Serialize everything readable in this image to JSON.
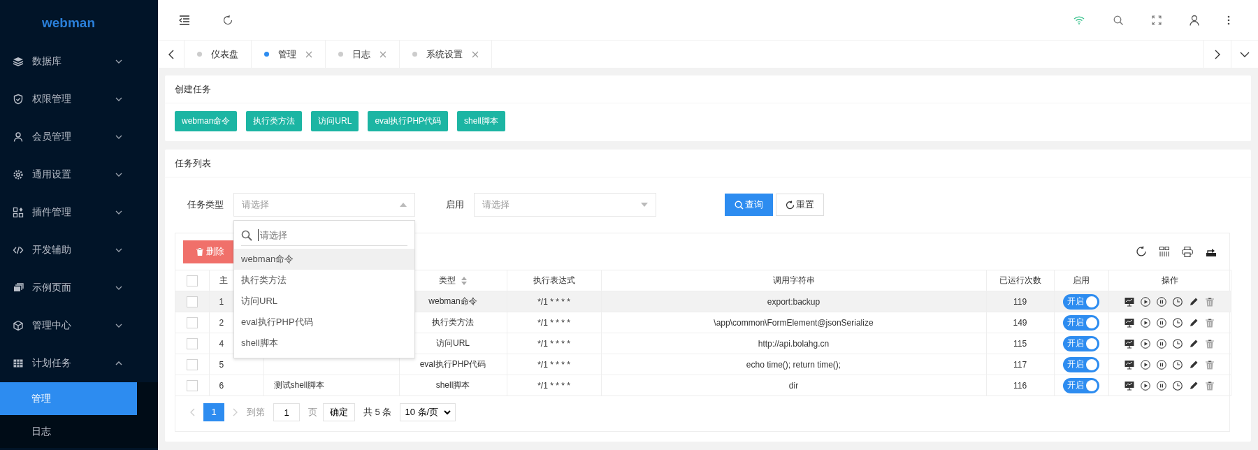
{
  "sidebar": {
    "logo": "webman",
    "items": [
      {
        "label": "数据库",
        "expanded": false
      },
      {
        "label": "权限管理",
        "expanded": false
      },
      {
        "label": "会员管理",
        "expanded": false
      },
      {
        "label": "通用设置",
        "expanded": false
      },
      {
        "label": "插件管理",
        "expanded": false
      },
      {
        "label": "开发辅助",
        "expanded": false
      },
      {
        "label": "示例页面",
        "expanded": false
      },
      {
        "label": "管理中心",
        "expanded": false
      },
      {
        "label": "计划任务",
        "expanded": true,
        "children": [
          {
            "label": "管理",
            "selected": true
          },
          {
            "label": "日志",
            "selected": false
          }
        ]
      }
    ]
  },
  "tabs": [
    {
      "label": "仪表盘",
      "selected": false,
      "closable": false
    },
    {
      "label": "管理",
      "selected": true,
      "closable": true
    },
    {
      "label": "日志",
      "selected": false,
      "closable": true
    },
    {
      "label": "系统设置",
      "selected": false,
      "closable": true
    }
  ],
  "create_card": {
    "title": "创建任务",
    "buttons": [
      "webman命令",
      "执行类方法",
      "访问URL",
      "eval执行PHP代码",
      "shell脚本"
    ]
  },
  "list_card": {
    "title": "任务列表",
    "filters": [
      {
        "label": "任务类型",
        "placeholder": "请选择",
        "expanded": true
      },
      {
        "label": "启用",
        "placeholder": "请选择",
        "expanded": false
      }
    ],
    "buttons": [
      {
        "label": "查询",
        "kind": "primary"
      },
      {
        "label": "重置",
        "kind": "default"
      }
    ],
    "dropdown": {
      "search_placeholder": "请选择",
      "options": [
        {
          "label": "webman命令",
          "highlighted": true
        },
        {
          "label": "执行类方法",
          "highlighted": false
        },
        {
          "label": "访问URL",
          "highlighted": false
        },
        {
          "label": "eval执行PHP代码",
          "highlighted": false
        },
        {
          "label": "shell脚本",
          "highlighted": false
        }
      ]
    },
    "delete_button": "删除",
    "table": {
      "columns": [
        {
          "kind": "check",
          "checked": false
        },
        {
          "label": "主"
        },
        {
          "kind": "blank"
        },
        {
          "label": "类型",
          "sortable": true
        },
        {
          "label": "执行表达式"
        },
        {
          "label": "调用字符串"
        },
        {
          "label": "已运行次数"
        },
        {
          "label": "启用"
        },
        {
          "label": "操作"
        }
      ],
      "rows": [
        {
          "checked": false,
          "highlighted": true,
          "id": "1",
          "type": "webman命令",
          "cron": "*/1 * * * *",
          "target": "export:backup",
          "runs": "119",
          "enabled": true,
          "switch_label": "开启"
        },
        {
          "checked": false,
          "highlighted": false,
          "id": "2",
          "type": "执行类方法",
          "cron": "*/1 * * * *",
          "target": "\\app\\common\\FormElement@jsonSerialize",
          "runs": "149",
          "enabled": true,
          "switch_label": "开启"
        },
        {
          "checked": false,
          "highlighted": false,
          "id": "4",
          "type": "访问URL",
          "cron": "*/1 * * * *",
          "target": "http://api.bolahg.cn",
          "runs": "115",
          "enabled": true,
          "switch_label": "开启"
        },
        {
          "checked": false,
          "highlighted": false,
          "id": "5",
          "type": "eval执行PHP代码",
          "cron": "*/1 * * * *",
          "target": "echo time(); return time();",
          "runs": "117",
          "enabled": true,
          "switch_label": "开启"
        },
        {
          "checked": false,
          "highlighted": false,
          "id": "6",
          "name": "测试shell脚本",
          "type": "shell脚本",
          "cron": "*/1 * * * *",
          "target": "dir",
          "runs": "116",
          "enabled": true,
          "switch_label": "开启"
        }
      ]
    },
    "pagination": {
      "pages": [
        {
          "label": "1",
          "selected": true
        }
      ],
      "goto_label": "到第",
      "page_value": "1",
      "page_suffix": "页",
      "confirm": "确定",
      "total": "共 5 条",
      "page_size": "10 条/页"
    }
  }
}
